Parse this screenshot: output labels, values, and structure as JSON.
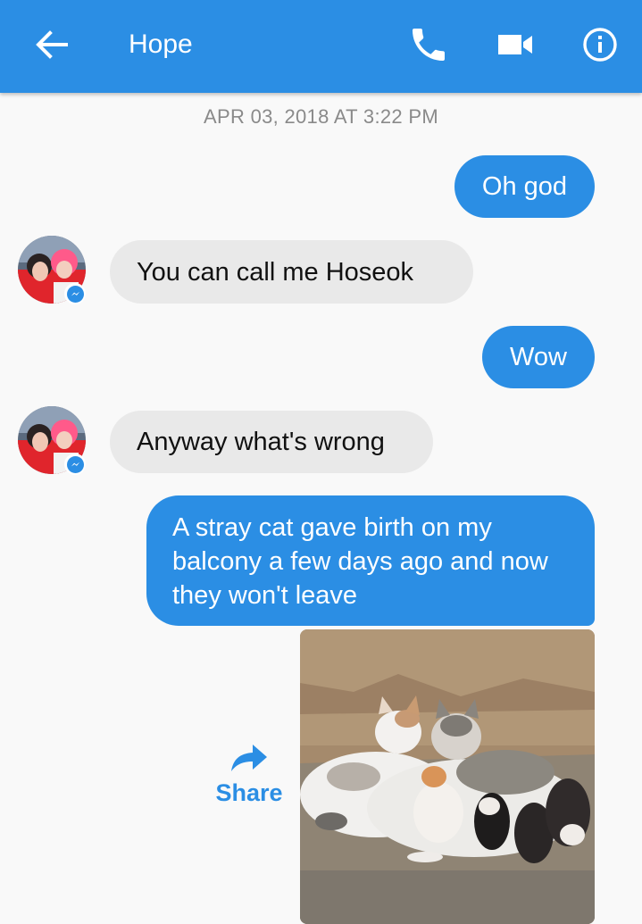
{
  "header": {
    "contact_name": "Hope",
    "icons": [
      "back-arrow-icon",
      "phone-call-icon",
      "video-call-icon",
      "info-icon"
    ],
    "background_color": "#2b8ee4"
  },
  "conversation": {
    "timestamp": "APR 03, 2018 AT 3:22 PM",
    "messages": [
      {
        "sender": "me",
        "text": "Oh god"
      },
      {
        "sender": "contact",
        "text": "You can call me Hoseok"
      },
      {
        "sender": "me",
        "text": "Wow"
      },
      {
        "sender": "contact",
        "text": "Anyway what's wrong"
      },
      {
        "sender": "me",
        "text": "A stray cat gave birth on my balcony a few days ago and now they won't leave"
      }
    ],
    "attachment": {
      "type": "photo",
      "share_label": "Share"
    }
  },
  "colors": {
    "outgoing_bubble": "#2b8ee4",
    "incoming_bubble": "#e9e9e9",
    "background": "#f9f9f9",
    "timestamp_text": "#8a8a8a"
  }
}
